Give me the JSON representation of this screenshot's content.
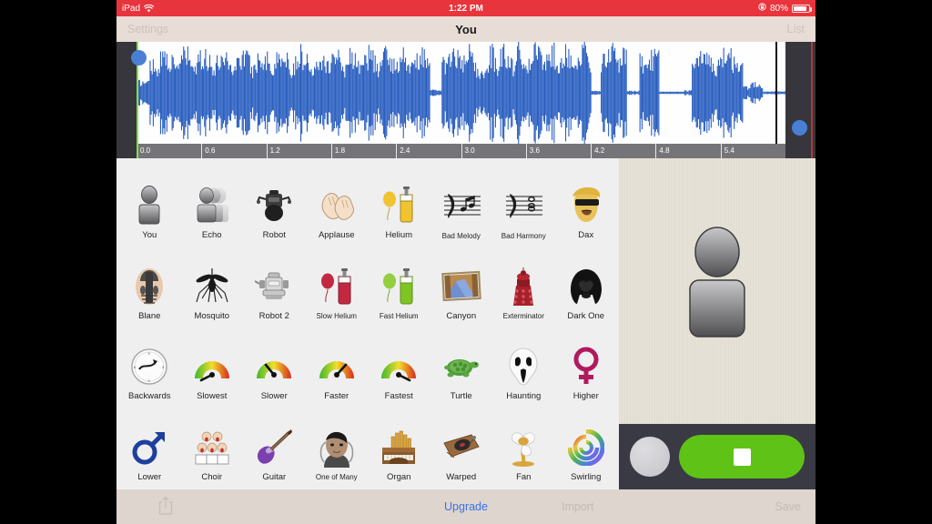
{
  "status_bar": {
    "carrier": "iPad",
    "wifi_icon": "wifi-icon",
    "time": "1:22 PM",
    "rotation_lock_icon": "rotation-lock-icon",
    "battery_percent": "80%",
    "battery_level": 80
  },
  "nav_bar": {
    "left_label": "Settings",
    "title": "You",
    "right_label": "List"
  },
  "waveform": {
    "timeline_ticks": [
      "0.0",
      "0.6",
      "1.2",
      "1.8",
      "2.4",
      "3.0",
      "3.6",
      "4.2",
      "4.8",
      "5.4"
    ],
    "selection_start_color": "#7fe04a",
    "selection_end_color": "#b03a3a",
    "wave_color": "#2a5fc0",
    "playhead_color": "#111111",
    "handle_color": "#4a7fd6",
    "duration_label": "5.4"
  },
  "effects": {
    "rows": [
      [
        {
          "label": "You",
          "icon": "person-icon"
        },
        {
          "label": "Echo",
          "icon": "people-echo-icon"
        },
        {
          "label": "Robot",
          "icon": "robot-icon"
        },
        {
          "label": "Applause",
          "icon": "clapping-hands-icon"
        },
        {
          "label": "Helium",
          "icon": "balloon-gas-tank-icon"
        },
        {
          "label": "Bad Melody",
          "icon": "music-notes-icon"
        },
        {
          "label": "Bad Harmony",
          "icon": "music-chord-icon"
        },
        {
          "label": "Dax",
          "icon": "dax-face-icon"
        }
      ],
      [
        {
          "label": "Blane",
          "icon": "blane-mask-icon"
        },
        {
          "label": "Mosquito",
          "icon": "mosquito-icon"
        },
        {
          "label": "Robot 2",
          "icon": "robot2-icon"
        },
        {
          "label": "Slow Helium",
          "icon": "red-balloon-tank-icon"
        },
        {
          "label": "Fast Helium",
          "icon": "green-balloon-tank-icon"
        },
        {
          "label": "Canyon",
          "icon": "canyon-painting-icon"
        },
        {
          "label": "Exterminator",
          "icon": "dalek-icon"
        },
        {
          "label": "Dark One",
          "icon": "dark-helmet-icon"
        }
      ],
      [
        {
          "label": "Backwards",
          "icon": "clock-reverse-icon"
        },
        {
          "label": "Slowest",
          "icon": "gauge-slowest-icon"
        },
        {
          "label": "Slower",
          "icon": "gauge-slower-icon"
        },
        {
          "label": "Faster",
          "icon": "gauge-faster-icon"
        },
        {
          "label": "Fastest",
          "icon": "gauge-fastest-icon"
        },
        {
          "label": "Turtle",
          "icon": "turtle-icon"
        },
        {
          "label": "Haunting",
          "icon": "ghost-mask-icon"
        },
        {
          "label": "Higher",
          "icon": "venus-symbol-icon"
        }
      ],
      [
        {
          "label": "Lower",
          "icon": "mars-symbol-icon"
        },
        {
          "label": "Choir",
          "icon": "choir-icon"
        },
        {
          "label": "Guitar",
          "icon": "guitar-icon"
        },
        {
          "label": "One of Many",
          "icon": "crowd-face-icon"
        },
        {
          "label": "Organ",
          "icon": "organ-icon"
        },
        {
          "label": "Warped",
          "icon": "turntable-icon"
        },
        {
          "label": "Fan",
          "icon": "fan-icon"
        },
        {
          "label": "Swirling",
          "icon": "swirl-icon"
        }
      ]
    ],
    "selected": "You"
  },
  "preview": {
    "avatar_icon": "person-icon",
    "record_circle_icon": "record-circle-button",
    "stop_button_icon": "stop-square-icon",
    "stop_button_color": "#5fc216"
  },
  "bottom_bar": {
    "share_icon": "share-icon",
    "upgrade_label": "Upgrade",
    "import_label": "Import",
    "save_label": "Save",
    "accent_color": "#3a72e8"
  }
}
